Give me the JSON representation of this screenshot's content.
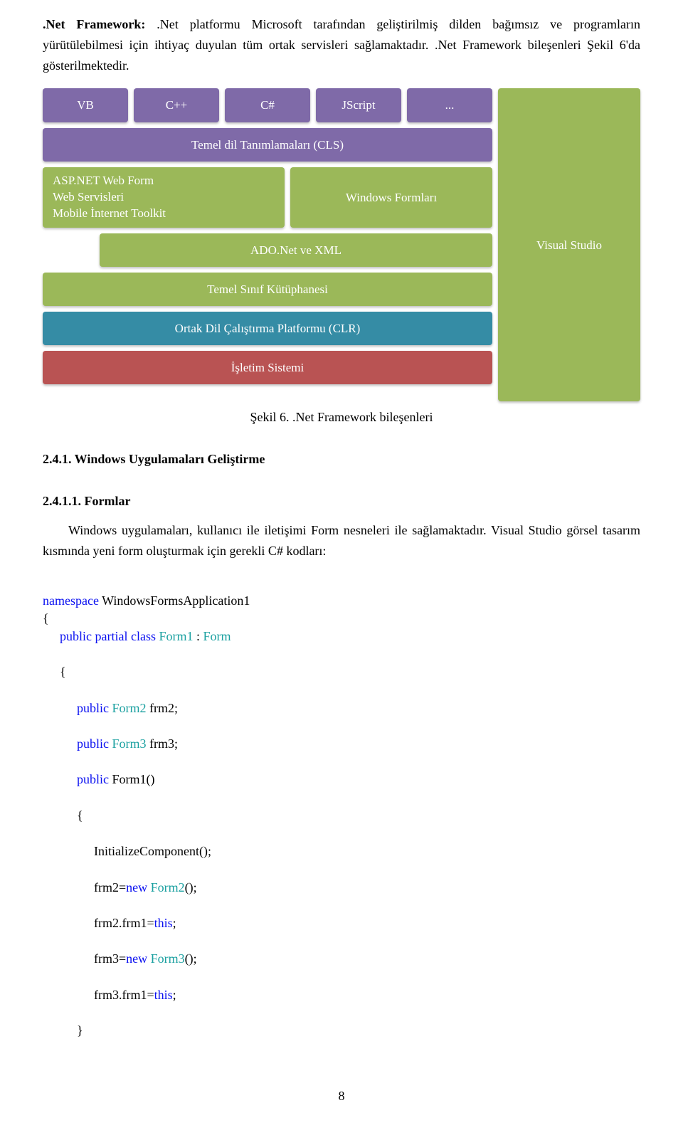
{
  "intro": {
    "label_bold": ".Net Framework:",
    "text": " .Net platformu Microsoft tarafından geliştirilmiş dilden bağımsız ve programların yürütülebilmesi için ihtiyaç duyulan tüm ortak servisleri sağlamaktadır. .Net Framework bileşenleri Şekil 6'da gösterilmektedir."
  },
  "diagram": {
    "langs": [
      "VB",
      "C++",
      "C#",
      "JScript",
      "..."
    ],
    "cls": "Temel dil Tanımlamaları (CLS)",
    "asp_lines": [
      "ASP.NET Web Form",
      "Web Servisleri",
      "Mobile İnternet Toolkit"
    ],
    "winforms": "Windows Formları",
    "ado": "ADO.Net ve XML",
    "bcl": "Temel Sınıf Kütüphanesi",
    "clr": "Ortak Dil Çalıştırma Platformu (CLR)",
    "os": "İşletim Sistemi",
    "vs": "Visual Studio",
    "caption": "Şekil 6. .Net Framework bileşenleri"
  },
  "headings": {
    "h241": "2.4.1. Windows Uygulamaları Geliştirme",
    "h2411": "2.4.1.1. Formlar"
  },
  "forms_para": "Windows uygulamaları, kullanıcı ile iletişimi Form nesneleri ile sağlamaktadır. Visual Studio görsel tasarım kısmında yeni form oluşturmak için gerekli C# kodları:",
  "code": {
    "l1a": "namespace",
    "l1b": " WindowsFormsApplication1",
    "l2": "{",
    "l3a": "public",
    "l3b": " ",
    "l3c": "partial",
    "l3d": " ",
    "l3e": "class",
    "l3f": " ",
    "l3g": "Form1",
    "l3h": " : ",
    "l3i": "Form",
    "l4": "{",
    "l5a": "public",
    "l5b": " ",
    "l5c": "Form2",
    "l5d": " frm2;",
    "l6a": "public",
    "l6b": " ",
    "l6c": "Form3",
    "l6d": " frm3;",
    "l7a": "public",
    "l7b": " Form1()",
    "l8": "{",
    "l9": "InitializeComponent();",
    "l10a": "frm2=",
    "l10b": "new",
    "l10c": " ",
    "l10d": "Form2",
    "l10e": "();",
    "l11a": "frm2.frm1=",
    "l11b": "this",
    "l11c": ";",
    "l12a": "frm3=",
    "l12b": "new",
    "l12c": " ",
    "l12d": "Form3",
    "l12e": "();",
    "l13a": "frm3.frm1=",
    "l13b": "this",
    "l13c": ";",
    "l14": "}"
  },
  "pagenum": "8"
}
